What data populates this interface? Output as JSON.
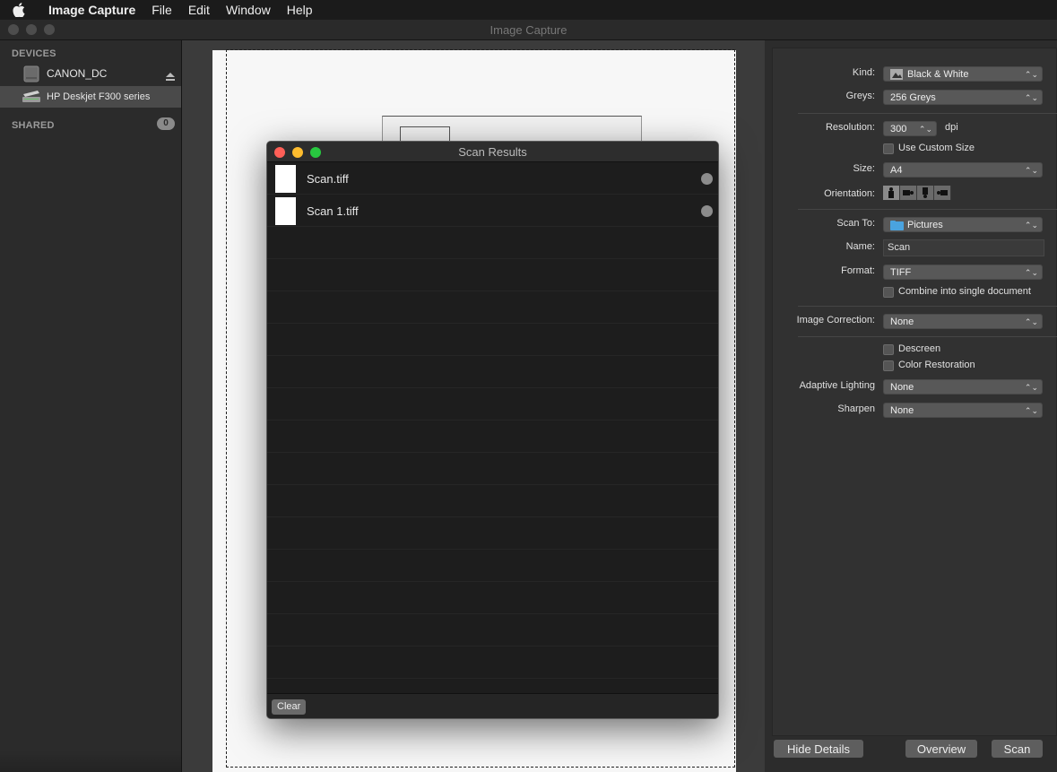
{
  "menubar": {
    "app_name": "Image Capture",
    "items": [
      "File",
      "Edit",
      "Window",
      "Help"
    ]
  },
  "window": {
    "title": "Image Capture"
  },
  "sidebar": {
    "devices_header": "DEVICES",
    "devices": [
      {
        "label": "CANON_DC",
        "icon": "drive-icon"
      },
      {
        "label": "HP Deskjet F300 series",
        "icon": "scanner-icon"
      }
    ],
    "shared_header": "SHARED",
    "shared_count": "0"
  },
  "scan_results": {
    "title": "Scan Results",
    "files": [
      {
        "name": "Scan.tiff"
      },
      {
        "name": "Scan 1.tiff"
      }
    ],
    "clear_label": "Clear"
  },
  "details": {
    "kind": {
      "label": "Kind:",
      "value": "Black & White"
    },
    "greys": {
      "label": "Greys:",
      "value": "256 Greys"
    },
    "resolution": {
      "label": "Resolution:",
      "value": "300",
      "unit": "dpi"
    },
    "use_custom_size": {
      "label": "Use Custom Size",
      "checked": false
    },
    "size": {
      "label": "Size:",
      "value": "A4"
    },
    "orientation": {
      "label": "Orientation:"
    },
    "scan_to": {
      "label": "Scan To:",
      "value": "Pictures"
    },
    "name": {
      "label": "Name:",
      "value": "Scan"
    },
    "format": {
      "label": "Format:",
      "value": "TIFF"
    },
    "combine": {
      "label": "Combine into single document",
      "checked": false
    },
    "image_correction": {
      "label": "Image Correction:",
      "value": "None"
    },
    "descreen": {
      "label": "Descreen",
      "checked": false
    },
    "color_restoration": {
      "label": "Color Restoration",
      "checked": false
    },
    "adaptive_lighting": {
      "label": "Adaptive Lighting",
      "value": "None"
    },
    "sharpen": {
      "label": "Sharpen",
      "value": "None"
    }
  },
  "buttons": {
    "hide_details": "Hide Details",
    "overview": "Overview",
    "scan": "Scan"
  },
  "colors": {
    "close": "#ff5f57",
    "minimize": "#febc2e",
    "zoom": "#28c840",
    "folder": "#4aa3df"
  }
}
